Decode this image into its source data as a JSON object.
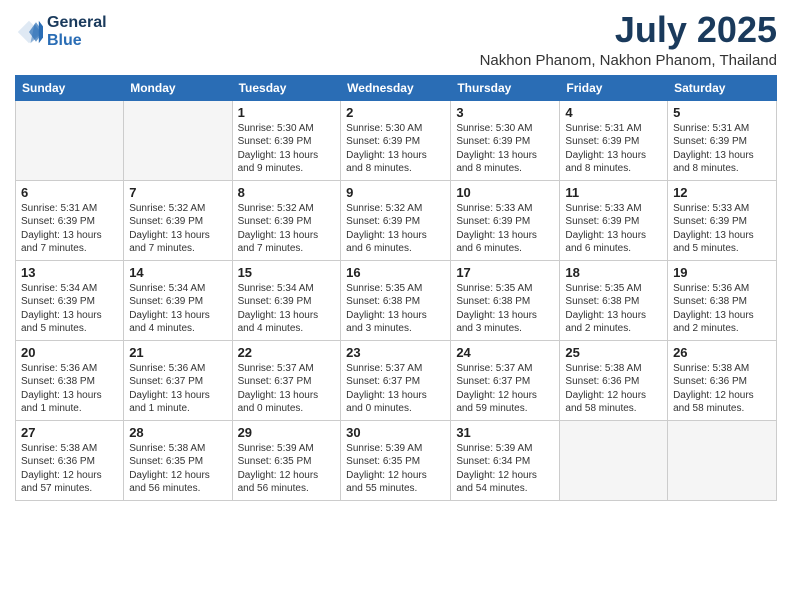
{
  "header": {
    "logo_line1": "General",
    "logo_line2": "Blue",
    "main_title": "July 2025",
    "subtitle": "Nakhon Phanom, Nakhon Phanom, Thailand"
  },
  "days_of_week": [
    "Sunday",
    "Monday",
    "Tuesday",
    "Wednesday",
    "Thursday",
    "Friday",
    "Saturday"
  ],
  "weeks": [
    [
      {
        "day": "",
        "info": ""
      },
      {
        "day": "",
        "info": ""
      },
      {
        "day": "1",
        "info": "Sunrise: 5:30 AM\nSunset: 6:39 PM\nDaylight: 13 hours\nand 9 minutes."
      },
      {
        "day": "2",
        "info": "Sunrise: 5:30 AM\nSunset: 6:39 PM\nDaylight: 13 hours\nand 8 minutes."
      },
      {
        "day": "3",
        "info": "Sunrise: 5:30 AM\nSunset: 6:39 PM\nDaylight: 13 hours\nand 8 minutes."
      },
      {
        "day": "4",
        "info": "Sunrise: 5:31 AM\nSunset: 6:39 PM\nDaylight: 13 hours\nand 8 minutes."
      },
      {
        "day": "5",
        "info": "Sunrise: 5:31 AM\nSunset: 6:39 PM\nDaylight: 13 hours\nand 8 minutes."
      }
    ],
    [
      {
        "day": "6",
        "info": "Sunrise: 5:31 AM\nSunset: 6:39 PM\nDaylight: 13 hours\nand 7 minutes."
      },
      {
        "day": "7",
        "info": "Sunrise: 5:32 AM\nSunset: 6:39 PM\nDaylight: 13 hours\nand 7 minutes."
      },
      {
        "day": "8",
        "info": "Sunrise: 5:32 AM\nSunset: 6:39 PM\nDaylight: 13 hours\nand 7 minutes."
      },
      {
        "day": "9",
        "info": "Sunrise: 5:32 AM\nSunset: 6:39 PM\nDaylight: 13 hours\nand 6 minutes."
      },
      {
        "day": "10",
        "info": "Sunrise: 5:33 AM\nSunset: 6:39 PM\nDaylight: 13 hours\nand 6 minutes."
      },
      {
        "day": "11",
        "info": "Sunrise: 5:33 AM\nSunset: 6:39 PM\nDaylight: 13 hours\nand 6 minutes."
      },
      {
        "day": "12",
        "info": "Sunrise: 5:33 AM\nSunset: 6:39 PM\nDaylight: 13 hours\nand 5 minutes."
      }
    ],
    [
      {
        "day": "13",
        "info": "Sunrise: 5:34 AM\nSunset: 6:39 PM\nDaylight: 13 hours\nand 5 minutes."
      },
      {
        "day": "14",
        "info": "Sunrise: 5:34 AM\nSunset: 6:39 PM\nDaylight: 13 hours\nand 4 minutes."
      },
      {
        "day": "15",
        "info": "Sunrise: 5:34 AM\nSunset: 6:39 PM\nDaylight: 13 hours\nand 4 minutes."
      },
      {
        "day": "16",
        "info": "Sunrise: 5:35 AM\nSunset: 6:38 PM\nDaylight: 13 hours\nand 3 minutes."
      },
      {
        "day": "17",
        "info": "Sunrise: 5:35 AM\nSunset: 6:38 PM\nDaylight: 13 hours\nand 3 minutes."
      },
      {
        "day": "18",
        "info": "Sunrise: 5:35 AM\nSunset: 6:38 PM\nDaylight: 13 hours\nand 2 minutes."
      },
      {
        "day": "19",
        "info": "Sunrise: 5:36 AM\nSunset: 6:38 PM\nDaylight: 13 hours\nand 2 minutes."
      }
    ],
    [
      {
        "day": "20",
        "info": "Sunrise: 5:36 AM\nSunset: 6:38 PM\nDaylight: 13 hours\nand 1 minute."
      },
      {
        "day": "21",
        "info": "Sunrise: 5:36 AM\nSunset: 6:37 PM\nDaylight: 13 hours\nand 1 minute."
      },
      {
        "day": "22",
        "info": "Sunrise: 5:37 AM\nSunset: 6:37 PM\nDaylight: 13 hours\nand 0 minutes."
      },
      {
        "day": "23",
        "info": "Sunrise: 5:37 AM\nSunset: 6:37 PM\nDaylight: 13 hours\nand 0 minutes."
      },
      {
        "day": "24",
        "info": "Sunrise: 5:37 AM\nSunset: 6:37 PM\nDaylight: 12 hours\nand 59 minutes."
      },
      {
        "day": "25",
        "info": "Sunrise: 5:38 AM\nSunset: 6:36 PM\nDaylight: 12 hours\nand 58 minutes."
      },
      {
        "day": "26",
        "info": "Sunrise: 5:38 AM\nSunset: 6:36 PM\nDaylight: 12 hours\nand 58 minutes."
      }
    ],
    [
      {
        "day": "27",
        "info": "Sunrise: 5:38 AM\nSunset: 6:36 PM\nDaylight: 12 hours\nand 57 minutes."
      },
      {
        "day": "28",
        "info": "Sunrise: 5:38 AM\nSunset: 6:35 PM\nDaylight: 12 hours\nand 56 minutes."
      },
      {
        "day": "29",
        "info": "Sunrise: 5:39 AM\nSunset: 6:35 PM\nDaylight: 12 hours\nand 56 minutes."
      },
      {
        "day": "30",
        "info": "Sunrise: 5:39 AM\nSunset: 6:35 PM\nDaylight: 12 hours\nand 55 minutes."
      },
      {
        "day": "31",
        "info": "Sunrise: 5:39 AM\nSunset: 6:34 PM\nDaylight: 12 hours\nand 54 minutes."
      },
      {
        "day": "",
        "info": ""
      },
      {
        "day": "",
        "info": ""
      }
    ]
  ]
}
